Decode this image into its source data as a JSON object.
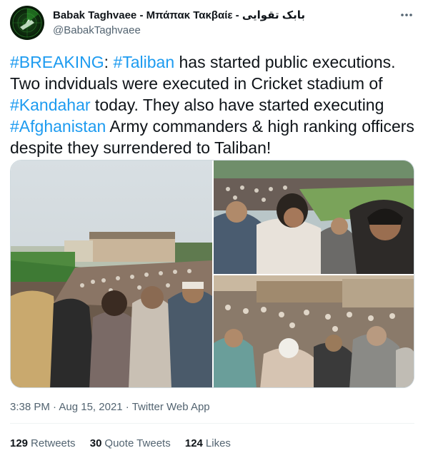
{
  "author": {
    "display_name": "Babak Taghvaee - Μπάπακ Τακβαίε - بابک تقوایی",
    "handle": "@BabakTaghvaee"
  },
  "more_icon": "more-horizontal-icon",
  "tweet": {
    "segments": [
      {
        "text": "#BREAKING",
        "type": "hashtag"
      },
      {
        "text": ": ",
        "type": "text"
      },
      {
        "text": "#Taliban",
        "type": "hashtag"
      },
      {
        "text": " has started public executions. Two indviduals were executed in Cricket stadium of ",
        "type": "text"
      },
      {
        "text": "#Kandahar",
        "type": "hashtag"
      },
      {
        "text": " today. They also have started executing ",
        "type": "text"
      },
      {
        "text": "#Afghanistan",
        "type": "hashtag"
      },
      {
        "text": " Army commanders & high ranking officers despite they surrendered to Taliban!",
        "type": "text"
      }
    ]
  },
  "meta": {
    "time": "3:38 PM",
    "date": "Aug 15, 2021",
    "source": "Twitter Web App",
    "separator": " · "
  },
  "stats": {
    "retweets_count": "129",
    "retweets_label": "Retweets",
    "quotes_count": "30",
    "quotes_label": "Quote Tweets",
    "likes_count": "124",
    "likes_label": "Likes"
  },
  "colors": {
    "link": "#1d9bf0",
    "secondary_text": "#536471",
    "primary_text": "#0f1419",
    "divider": "#eff3f4"
  }
}
